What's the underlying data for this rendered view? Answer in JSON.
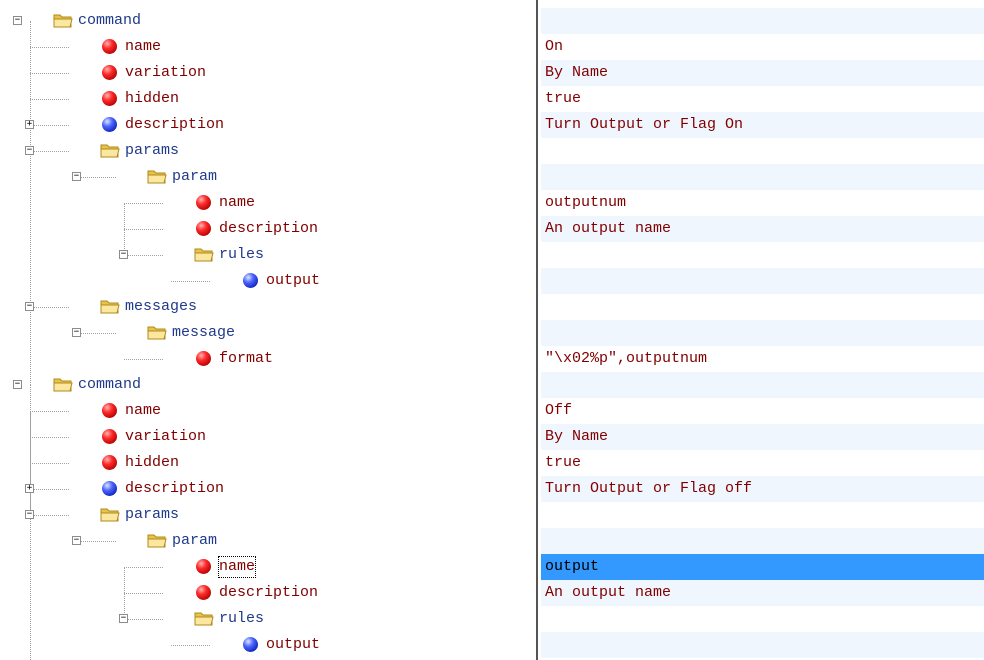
{
  "tree": [
    {
      "label": "command",
      "kind": "folder",
      "depth": 0,
      "expander": "minus",
      "value": ""
    },
    {
      "label": "name",
      "kind": "red",
      "depth": 1,
      "expander": "",
      "value": "On"
    },
    {
      "label": "variation",
      "kind": "red",
      "depth": 1,
      "expander": "",
      "value": "By Name"
    },
    {
      "label": "hidden",
      "kind": "red",
      "depth": 1,
      "expander": "",
      "value": "true"
    },
    {
      "label": "description",
      "kind": "blue",
      "depth": 1,
      "expander": "plus",
      "value": "Turn Output or Flag On"
    },
    {
      "label": "params",
      "kind": "folder",
      "depth": 1,
      "expander": "minus",
      "value": ""
    },
    {
      "label": "param",
      "kind": "folder",
      "depth": 2,
      "expander": "minus",
      "value": ""
    },
    {
      "label": "name",
      "kind": "red",
      "depth": 3,
      "expander": "",
      "value": "outputnum"
    },
    {
      "label": "description",
      "kind": "red",
      "depth": 3,
      "expander": "",
      "value": "An output name"
    },
    {
      "label": "rules",
      "kind": "folder",
      "depth": 3,
      "expander": "minus",
      "value": ""
    },
    {
      "label": "output",
      "kind": "blue",
      "depth": 4,
      "expander": "",
      "value": ""
    },
    {
      "label": "messages",
      "kind": "folder",
      "depth": 1,
      "expander": "minus",
      "value": ""
    },
    {
      "label": "message",
      "kind": "folder",
      "depth": 2,
      "expander": "minus",
      "value": ""
    },
    {
      "label": "format",
      "kind": "red",
      "depth": 3,
      "expander": "",
      "value": "\"\\x02%p\",outputnum"
    },
    {
      "label": "command",
      "kind": "folder",
      "depth": 0,
      "expander": "minus",
      "value": ""
    },
    {
      "label": "name",
      "kind": "red",
      "depth": 1,
      "expander": "",
      "value": "Off"
    },
    {
      "label": "variation",
      "kind": "red",
      "depth": 1,
      "expander": "",
      "value": "By Name"
    },
    {
      "label": "hidden",
      "kind": "red",
      "depth": 1,
      "expander": "",
      "value": "true"
    },
    {
      "label": "description",
      "kind": "blue",
      "depth": 1,
      "expander": "plus",
      "value": "Turn Output or Flag off"
    },
    {
      "label": "params",
      "kind": "folder",
      "depth": 1,
      "expander": "minus",
      "value": ""
    },
    {
      "label": "param",
      "kind": "folder",
      "depth": 2,
      "expander": "minus",
      "value": ""
    },
    {
      "label": "name",
      "kind": "red",
      "depth": 3,
      "expander": "",
      "value": "output",
      "selected": true
    },
    {
      "label": "description",
      "kind": "red",
      "depth": 3,
      "expander": "",
      "value": "An output name"
    },
    {
      "label": "rules",
      "kind": "folder",
      "depth": 3,
      "expander": "minus",
      "value": ""
    },
    {
      "label": "output",
      "kind": "blue",
      "depth": 4,
      "expander": "",
      "value": ""
    }
  ],
  "colors": {
    "selection": "#3399ff",
    "alt_row": "#f0f6fd",
    "folder_label": "#1f3a8a",
    "leaf_label": "#800000"
  },
  "icons": {
    "folder": "folder-icon",
    "red": "red-ball-icon",
    "blue": "blue-ball-icon",
    "plus": "expand-plus-icon",
    "minus": "collapse-minus-icon"
  }
}
